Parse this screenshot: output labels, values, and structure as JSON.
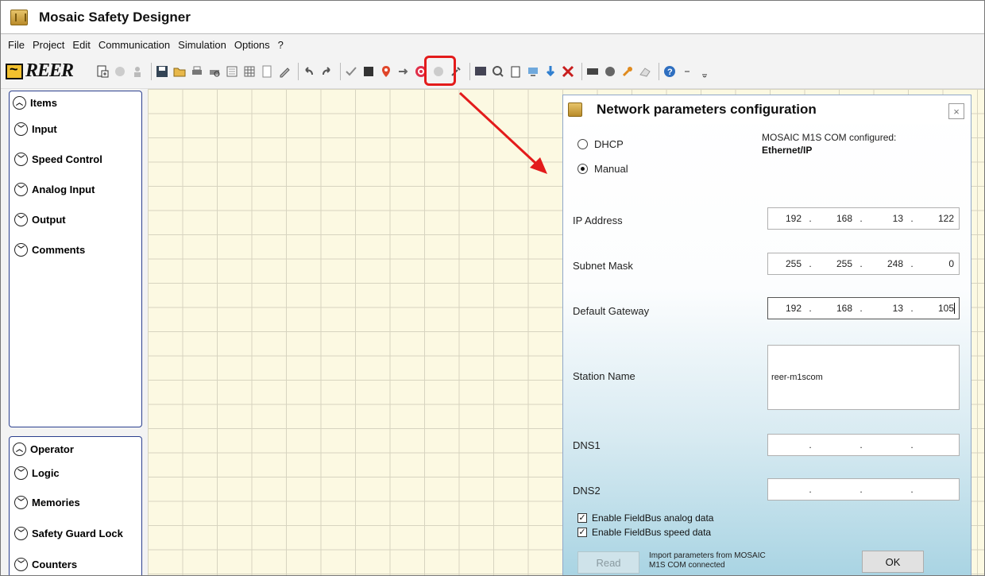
{
  "app": {
    "title": "Mosaic Safety Designer"
  },
  "menu": [
    "File",
    "Project",
    "Edit",
    "Communication",
    "Simulation",
    "Options",
    "?"
  ],
  "logo": {
    "text": "REER"
  },
  "sidebar": {
    "items_panel": {
      "header": "Items",
      "entries": [
        "Input",
        "Speed Control",
        "Analog Input",
        "Output",
        "Comments"
      ]
    },
    "operator_panel": {
      "header": "Operator",
      "entries": [
        "Logic",
        "Memories",
        "Safety Guard Lock",
        "Counters"
      ]
    }
  },
  "dialog": {
    "title": "Network parameters configuration",
    "close_glyph": "×",
    "dhcp_label": "DHCP",
    "manual_label": "Manual",
    "mode_selected": "Manual",
    "configured_label": "MOSAIC M1S COM configured:",
    "configured_value": "Ethernet/IP",
    "ip_label": "IP Address",
    "ip": [
      "192",
      "168",
      "13",
      "122"
    ],
    "subnet_label": "Subnet Mask",
    "subnet": [
      "255",
      "255",
      "248",
      "0"
    ],
    "gateway_label": "Default Gateway",
    "gateway": [
      "192",
      "168",
      "13",
      "105"
    ],
    "station_label": "Station Name",
    "station_value": "reer-m1scom",
    "dns1_label": "DNS1",
    "dns2_label": "DNS2",
    "dot": ".",
    "enable_analog_label": "Enable FieldBus analog data",
    "enable_speed_label": "Enable FieldBus speed data",
    "check_glyph": "✓",
    "read_button": "Read",
    "import_text": "Import parameters from MOSAIC M1S COM connected",
    "ok_button": "OK"
  },
  "colors": {
    "highlight": "#e31b1b",
    "panel_border": "#2b3f8e",
    "canvas": "#fcf9e2"
  }
}
